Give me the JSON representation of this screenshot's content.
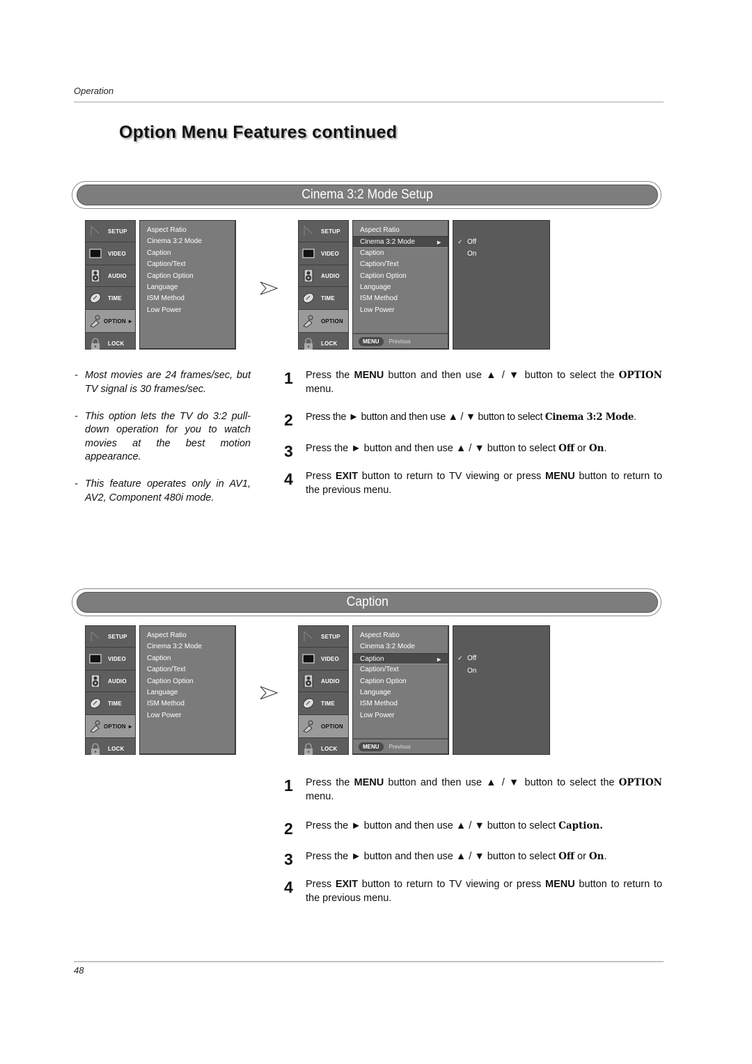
{
  "header": {
    "running_head": "Operation",
    "title": "Option Menu Features continued"
  },
  "osd_common": {
    "tabs": [
      {
        "label": "SETUP",
        "icon": "setup-icon"
      },
      {
        "label": "VIDEO",
        "icon": "video-icon"
      },
      {
        "label": "AUDIO",
        "icon": "audio-icon"
      },
      {
        "label": "TIME",
        "icon": "time-icon"
      },
      {
        "label": "OPTION",
        "icon": "option-icon"
      },
      {
        "label": "LOCK",
        "icon": "lock-icon"
      }
    ],
    "active_tab_label_with_arrow": "OPTION ►",
    "active_tab_label": "OPTION",
    "items": [
      "Aspect Ratio",
      "Cinema 3:2 Mode",
      "Caption",
      "Caption/Text",
      "Caption Option",
      "Language",
      "ISM Method",
      "Low Power"
    ],
    "footer_button": "MENU",
    "footer_label": "Previous",
    "submenu_options": [
      "Off",
      "On"
    ],
    "selected_option": "Off",
    "check_glyph": "✓",
    "item_arrow": "►"
  },
  "sections": [
    {
      "banner": "Cinema 3:2 Mode Setup",
      "selected_item": "Cinema 3:2 Mode",
      "notes": [
        "Most movies are 24 frames/sec, but TV signal is 30 frames/sec.",
        "This option lets the TV do 3:2 pull-down operation for you to watch movies at the best motion appearance.",
        "This feature operates only in AV1, AV2, Component 480i mode."
      ],
      "steps": [
        {
          "num": "1",
          "parts": [
            "Press the ",
            "MENU",
            " button and then use ▲ / ▼  button to select the ",
            "OPTION",
            " menu."
          ]
        },
        {
          "num": "2",
          "parts": [
            "Press the ► button and then use ▲ / ▼ button to select ",
            "Cinema 3:2 Mode",
            "."
          ]
        },
        {
          "num": "3",
          "parts": [
            "Press the ►  button and then use ▲ / ▼ button to select ",
            "Off",
            " or ",
            "On",
            "."
          ]
        },
        {
          "num": "4",
          "parts": [
            "Press ",
            "EXIT",
            " button to return to TV viewing or press ",
            "MENU",
            " button to return to the previous menu."
          ]
        }
      ]
    },
    {
      "banner": "Caption",
      "selected_item": "Caption",
      "steps": [
        {
          "num": "1",
          "parts": [
            "Press the ",
            "MENU",
            " button and then use ▲ / ▼  button to select the ",
            "OPTION",
            " menu."
          ]
        },
        {
          "num": "2",
          "parts": [
            "Press the ►  button and then use ▲ / ▼ button to select ",
            "Caption."
          ]
        },
        {
          "num": "3",
          "parts": [
            "Press the ►  button and then use ▲ / ▼ button to select ",
            "Off",
            " or ",
            "On",
            "."
          ]
        },
        {
          "num": "4",
          "parts": [
            "Press ",
            "EXIT",
            " button to return to TV viewing or press ",
            "MENU",
            " button to return to the previous menu."
          ]
        }
      ]
    }
  ],
  "footer": {
    "page_number": "48"
  }
}
